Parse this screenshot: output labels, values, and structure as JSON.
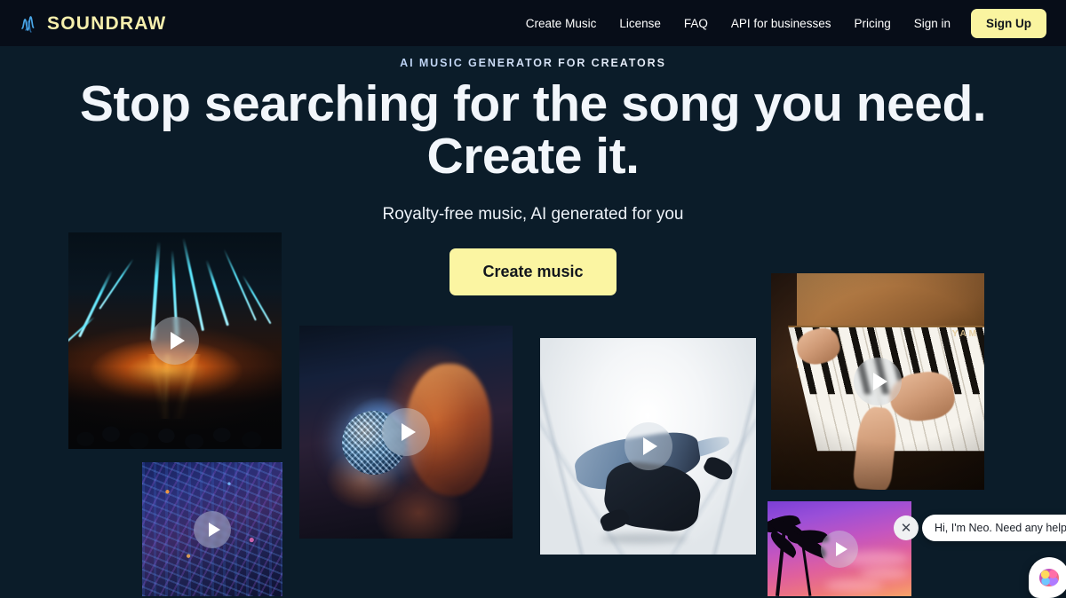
{
  "header": {
    "logo": {
      "text": "SOUNDRAW",
      "icon": "waveform-icon",
      "color": "#f6efad"
    },
    "nav": [
      {
        "label": "Create Music"
      },
      {
        "label": "License"
      },
      {
        "label": "FAQ"
      },
      {
        "label": "API for businesses"
      },
      {
        "label": "Pricing"
      },
      {
        "label": "Sign in"
      }
    ],
    "signup_label": "Sign Up",
    "background": "#070d18",
    "accent": "#faf4a0"
  },
  "hero": {
    "eyebrow": "AI MUSIC GENERATOR FOR CREATORS",
    "headline_line1": "Stop searching for the song you need.",
    "headline_line2": "Create it.",
    "subtitle": "Royalty-free music, AI generated for you",
    "cta_label": "Create music",
    "background": "#0b1c29"
  },
  "cards": [
    {
      "name": "concert-lasers",
      "alt": "Concert with teal laser beams over an orange-lit crowd",
      "play_icon": "play-icon"
    },
    {
      "name": "city-night",
      "alt": "Aerial night cityscape with blue and purple neon lights",
      "play_icon": "play-icon"
    },
    {
      "name": "disco-ball-woman",
      "alt": "Woman holding a mirrored disco ball in warm and blue light",
      "play_icon": "play-icon"
    },
    {
      "name": "breakdancer",
      "alt": "Breakdancer mid-move in a bright white corridor",
      "play_icon": "play-icon"
    },
    {
      "name": "piano-hands",
      "alt": "Hands playing a wooden Yamaha upright piano",
      "play_icon": "play-icon",
      "brand_text": "YAM"
    },
    {
      "name": "palm-sunset",
      "alt": "Palm trees silhouetted against a purple and pink sunset",
      "play_icon": "play-icon"
    }
  ],
  "chat": {
    "message": "Hi, I'm Neo. Need any help?",
    "close_label": "✕",
    "launcher_icon": "brain-icon"
  }
}
